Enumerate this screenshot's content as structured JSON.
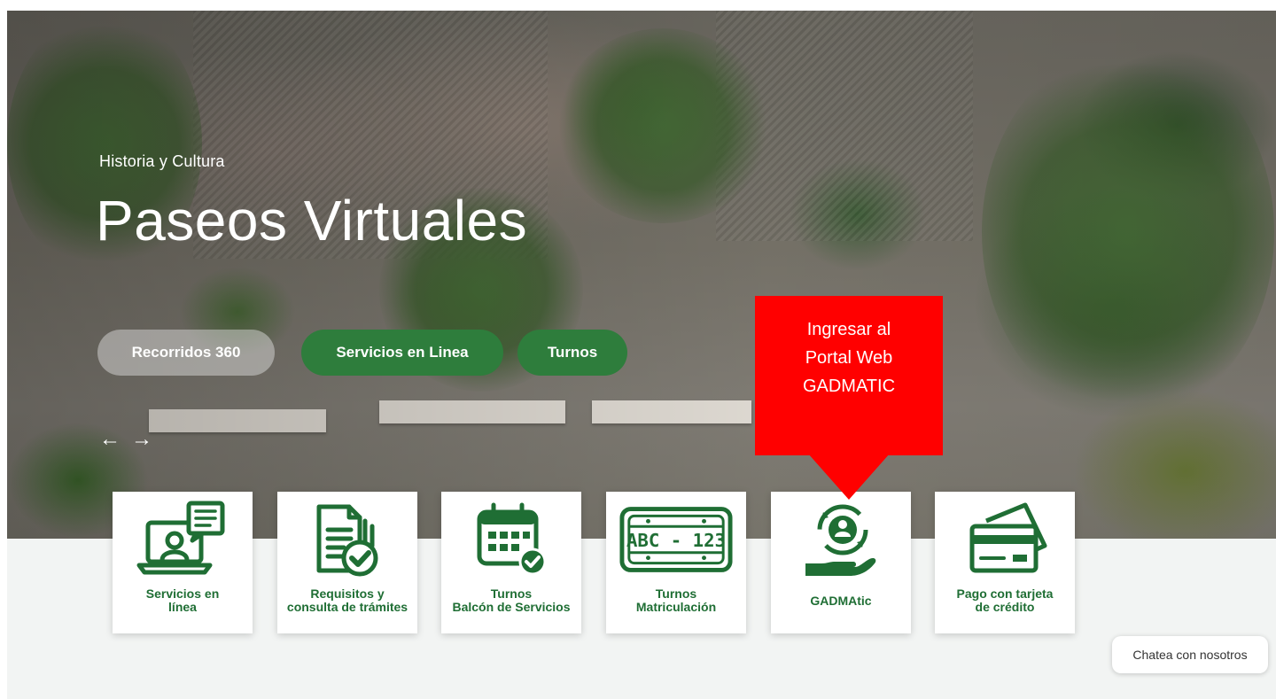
{
  "hero": {
    "eyebrow": "Historia y Cultura",
    "title": "Paseos Virtuales",
    "buttons": [
      "Recorridos 360",
      "Servicios en Linea",
      "Turnos"
    ],
    "prev_arrow": "←",
    "next_arrow": "→"
  },
  "callout": {
    "lines": [
      "Ingresar al",
      "Portal Web",
      "GADMATIC"
    ],
    "color": "#ff0000"
  },
  "cards": [
    {
      "label_lines": [
        "Servicios en",
        "línea"
      ],
      "icon": "online-services-icon"
    },
    {
      "label_lines": [
        "Requisitos y",
        "consulta de trámites"
      ],
      "icon": "requirements-check-icon"
    },
    {
      "label_lines": [
        "Turnos",
        "Balcón de Servicios"
      ],
      "icon": "calendar-check-icon"
    },
    {
      "label_lines": [
        "Turnos",
        "Matriculación"
      ],
      "icon": "license-plate-icon"
    },
    {
      "label_lines": [
        "GADMAtic"
      ],
      "icon": "gadmatic-user-hand-icon"
    },
    {
      "label_lines": [
        "Pago con tarjeta",
        "de crédito"
      ],
      "icon": "credit-card-icon"
    }
  ],
  "license_plate_text": "ABC - 123",
  "chat": {
    "label": "Chatea con nosotros"
  },
  "colors": {
    "brand_green": "#1f6e34",
    "button_green": "#2e7d3c",
    "band_grey": "#f2f4f3"
  }
}
